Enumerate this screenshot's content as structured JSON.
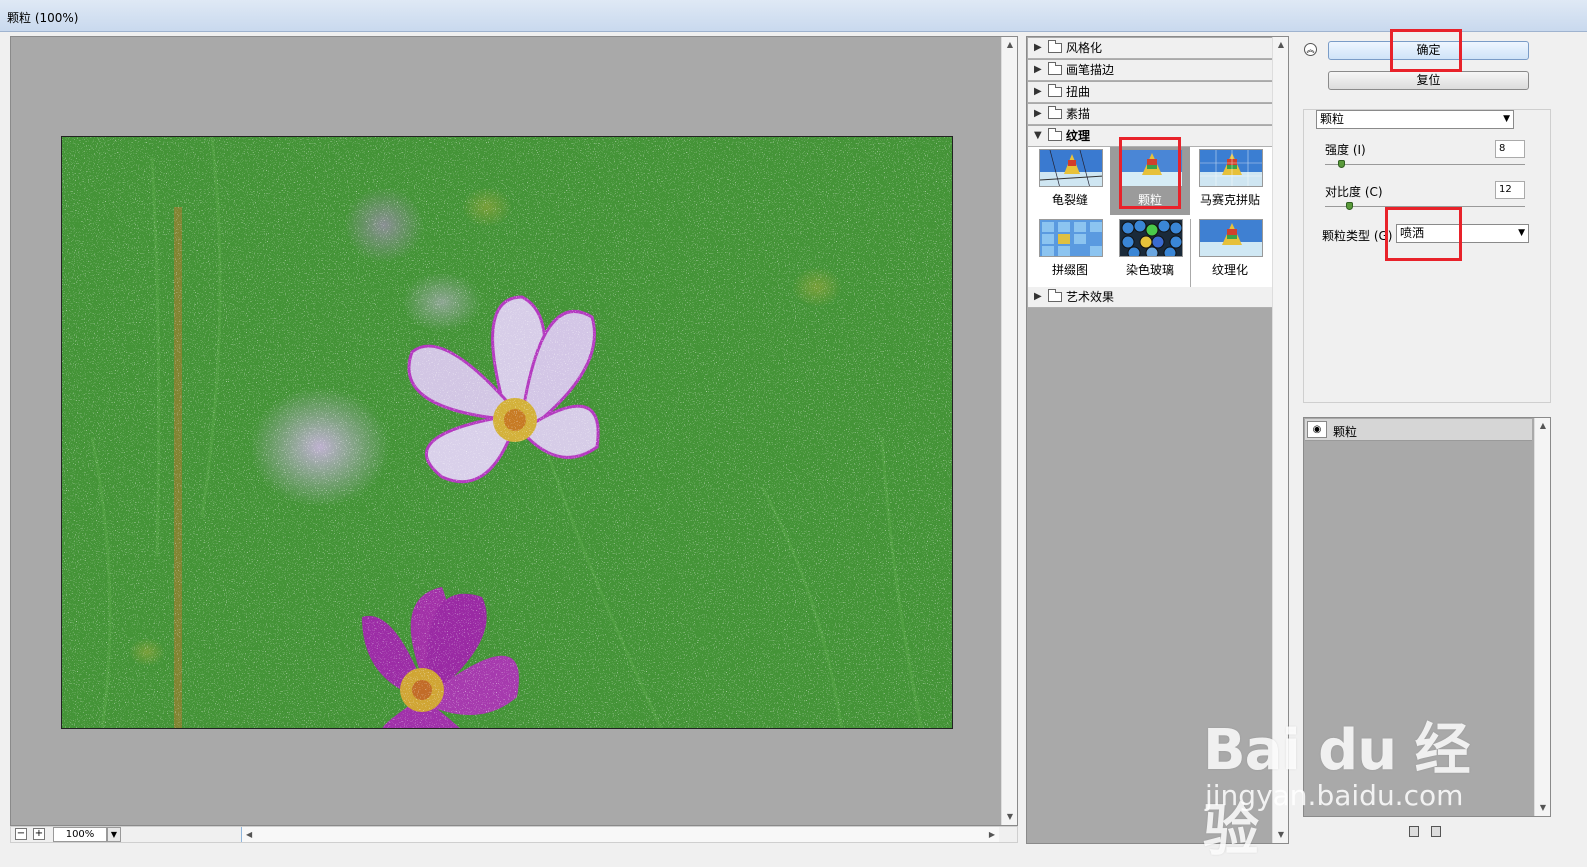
{
  "window": {
    "title": "颗粒 (100%)"
  },
  "preview": {
    "zoom": "100%",
    "zoom_minus": "−",
    "zoom_plus": "+"
  },
  "gallery": {
    "categories": [
      "风格化",
      "画笔描边",
      "扭曲",
      "素描",
      "纹理",
      "艺术效果"
    ],
    "thumbs": [
      "龟裂缝",
      "颗粒",
      "马赛克拼贴",
      "拼缀图",
      "染色玻璃",
      "纹理化"
    ],
    "selected": "颗粒"
  },
  "controls": {
    "ok_label": "确定",
    "reset_label": "复位",
    "filter_select": "颗粒",
    "intensity_label": "强度 (I)",
    "intensity_value": "8",
    "contrast_label": "对比度 (C)",
    "contrast_value": "12",
    "grain_type_label": "颗粒类型 (G)",
    "grain_type_value": "喷洒"
  },
  "layers": {
    "items": [
      "颗粒"
    ]
  },
  "watermark": {
    "brand": "Bai du 经验",
    "url": "jingyan.baidu.com"
  }
}
